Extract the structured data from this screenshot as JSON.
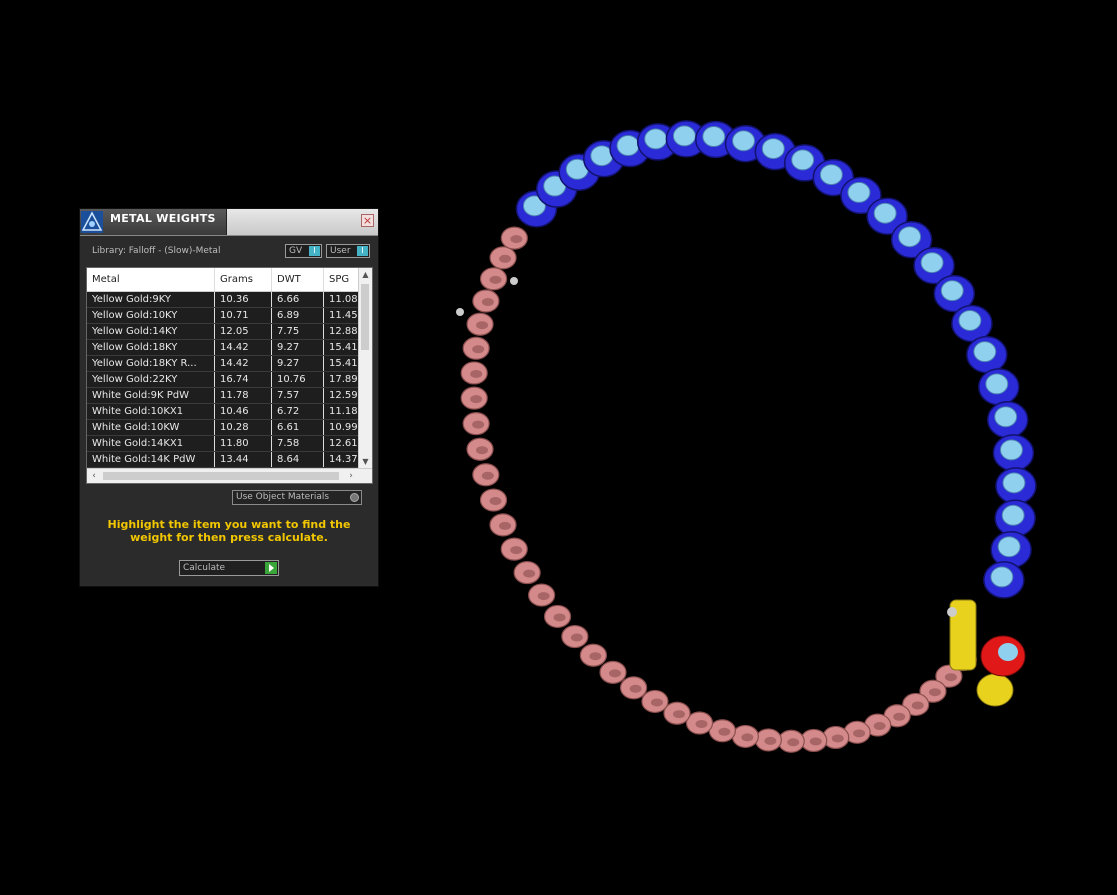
{
  "panel": {
    "title": "METAL WEIGHTS",
    "library_label": "Library: Falloff - (Slow)-Metal",
    "toggle_gv": "GV",
    "toggle_user": "User",
    "table": {
      "columns": [
        "Metal",
        "Grams",
        "DWT",
        "SPG"
      ],
      "rows": [
        [
          "Yellow Gold:9KY",
          "10.36",
          "6.66",
          "11.08"
        ],
        [
          "Yellow Gold:10KY",
          "10.71",
          "6.89",
          "11.45"
        ],
        [
          "Yellow Gold:14KY",
          "12.05",
          "7.75",
          "12.88"
        ],
        [
          "Yellow Gold:18KY",
          "14.42",
          "9.27",
          "15.41"
        ],
        [
          "Yellow Gold:18KY R...",
          "14.42",
          "9.27",
          "15.41"
        ],
        [
          "Yellow Gold:22KY",
          "16.74",
          "10.76",
          "17.89"
        ],
        [
          "White Gold:9K PdW",
          "11.78",
          "7.57",
          "12.59"
        ],
        [
          "White Gold:10KX1",
          "10.46",
          "6.72",
          "11.18"
        ],
        [
          "White Gold:10KW",
          "10.28",
          "6.61",
          "10.99"
        ],
        [
          "White Gold:14KX1",
          "11.80",
          "7.58",
          "12.61"
        ],
        [
          "White Gold:14K PdW",
          "13.44",
          "8.64",
          "14.37"
        ]
      ]
    },
    "use_object_materials": "Use Object Materials",
    "hint": "Highlight the item you want to find the weight for then press calculate.",
    "calculate_label": "Calculate"
  },
  "colors": {
    "viewport_bg": "#000000",
    "stone_metal": "#2a2ad6",
    "shank_metal": "#d48a8a",
    "stone": "#8fd0ee",
    "accent_yellow": "#e8d21e",
    "accent_red": "#e01818",
    "hint_text": "#f2c700"
  },
  "icons": {
    "app_logo": "app-logo-icon",
    "close": "close-icon",
    "calculate": "play-icon"
  }
}
